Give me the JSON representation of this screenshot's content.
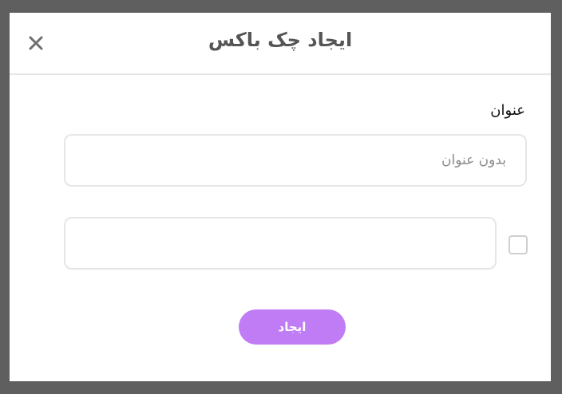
{
  "dialog": {
    "title": "ایجاد چک باکس",
    "close_icon": "close-icon",
    "field_label": "عنوان",
    "title_input": {
      "value": "",
      "placeholder": "بدون عنوان"
    },
    "option_input": {
      "value": "",
      "placeholder": ""
    },
    "checkbox_checked": false,
    "create_label": "ایجاد"
  },
  "colors": {
    "overlay": "#5f5f5f",
    "accent": "#c07cf5",
    "border": "#e6e6e6",
    "title_text": "#555555"
  }
}
